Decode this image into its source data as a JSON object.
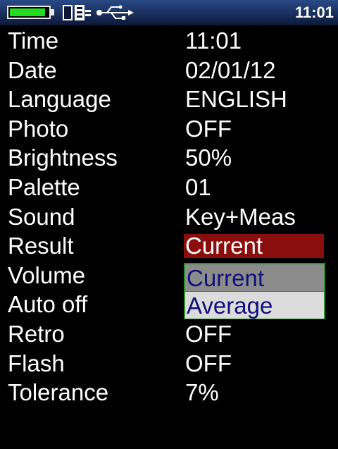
{
  "status_bar": {
    "time": "11:01",
    "battery_level": 0.92,
    "icons": [
      "battery-icon",
      "memory-card-icon",
      "usb-icon"
    ],
    "colors": {
      "battery": "#22dd22",
      "bar": "#1a2f5c"
    }
  },
  "settings": [
    {
      "label": "Time",
      "value": "11:01"
    },
    {
      "label": "Date",
      "value": "02/01/12"
    },
    {
      "label": "Language",
      "value": "ENGLISH"
    },
    {
      "label": "Photo",
      "value": "OFF"
    },
    {
      "label": "Brightness",
      "value": "50%"
    },
    {
      "label": "Palette",
      "value": "01"
    },
    {
      "label": "Sound",
      "value": "Key+Meas"
    },
    {
      "label": "Result",
      "value": "Current"
    },
    {
      "label": "Volume",
      "value": ""
    },
    {
      "label": "Auto off",
      "value": ""
    },
    {
      "label": "Retro",
      "value": "OFF"
    },
    {
      "label": "Flash",
      "value": "OFF"
    },
    {
      "label": "Tolerance",
      "value": "7%"
    }
  ],
  "result_dropdown": {
    "options": [
      "Current",
      "Average"
    ],
    "selected": "Current",
    "colors": {
      "highlight": "#8b0e0e",
      "option_text": "#10107a",
      "border": "#2e8b2e"
    }
  }
}
